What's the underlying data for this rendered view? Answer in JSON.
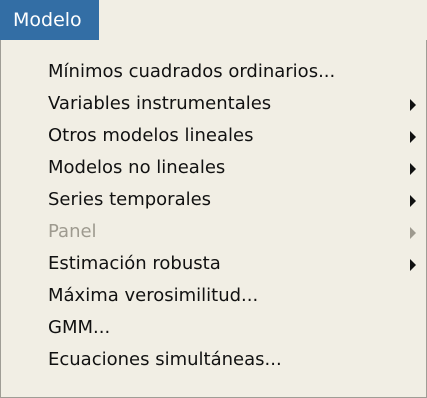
{
  "menubar": {
    "title": "Modelo"
  },
  "menu": {
    "items": [
      {
        "label": "Mínimos cuadrados ordinarios...",
        "submenu": false,
        "enabled": true
      },
      {
        "label": "Variables instrumentales",
        "submenu": true,
        "enabled": true
      },
      {
        "label": "Otros modelos lineales",
        "submenu": true,
        "enabled": true
      },
      {
        "label": "Modelos no lineales",
        "submenu": true,
        "enabled": true
      },
      {
        "label": "Series temporales",
        "submenu": true,
        "enabled": true
      },
      {
        "label": "Panel",
        "submenu": true,
        "enabled": false
      },
      {
        "label": "Estimación robusta",
        "submenu": true,
        "enabled": true
      },
      {
        "label": "Máxima verosimilitud...",
        "submenu": false,
        "enabled": true
      },
      {
        "label": "GMM...",
        "submenu": false,
        "enabled": true
      },
      {
        "label": "Ecuaciones simultáneas...",
        "submenu": false,
        "enabled": true
      }
    ]
  }
}
